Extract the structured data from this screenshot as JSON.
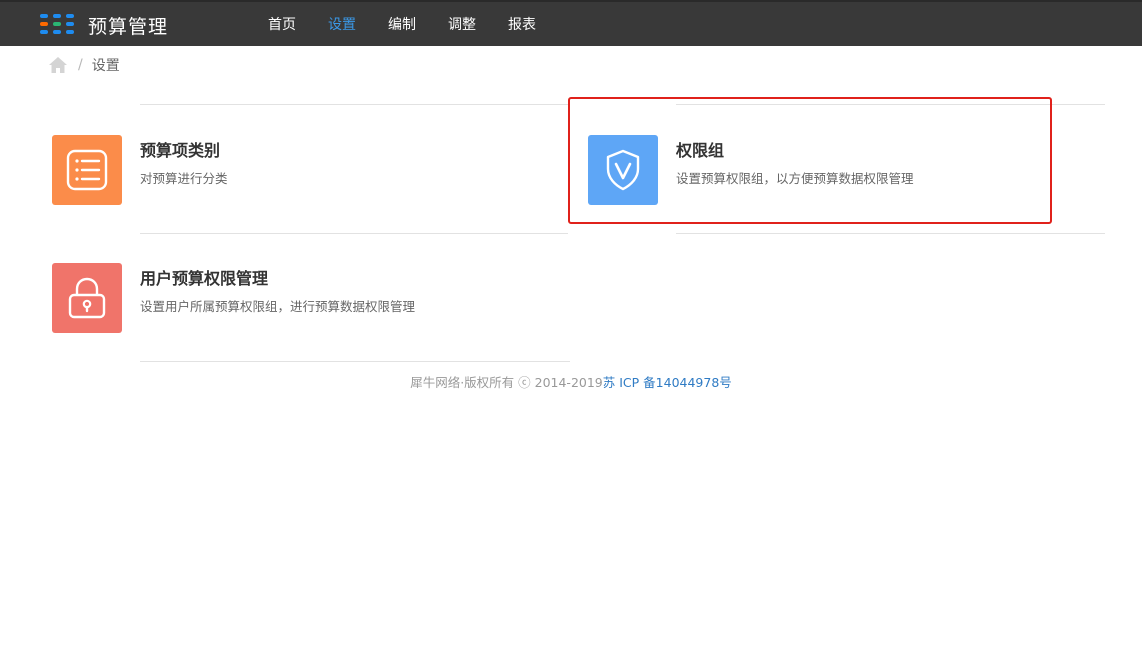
{
  "app": {
    "title": "预算管理"
  },
  "nav": {
    "items": [
      {
        "label": "首页",
        "active": false
      },
      {
        "label": "设置",
        "active": true
      },
      {
        "label": "编制",
        "active": false
      },
      {
        "label": "调整",
        "active": false
      },
      {
        "label": "报表",
        "active": false
      }
    ]
  },
  "breadcrumb": {
    "separator": "/",
    "current": "设置"
  },
  "cards": [
    {
      "title": "预算项类别",
      "desc": "对预算进行分类",
      "icon": "list-icon",
      "color": "#fb8c4a"
    },
    {
      "title": "权限组",
      "desc": "设置预算权限组，以方便预算数据权限管理",
      "icon": "shield-icon",
      "color": "#5ea6f6"
    },
    {
      "title": "用户预算权限管理",
      "desc": "设置用户所属预算权限组，进行预算数据权限管理",
      "icon": "lock-icon",
      "color": "#f0746a"
    }
  ],
  "footer": {
    "copyright": "犀牛网络·版权所有 ⓒ 2014-2019",
    "icp": "苏 ICP 备14044978号"
  },
  "colors": {
    "topbar": "#393939",
    "nav_active": "#3b99e8",
    "highlight_border": "#e0211b",
    "icp_link": "#2f7bc4"
  }
}
